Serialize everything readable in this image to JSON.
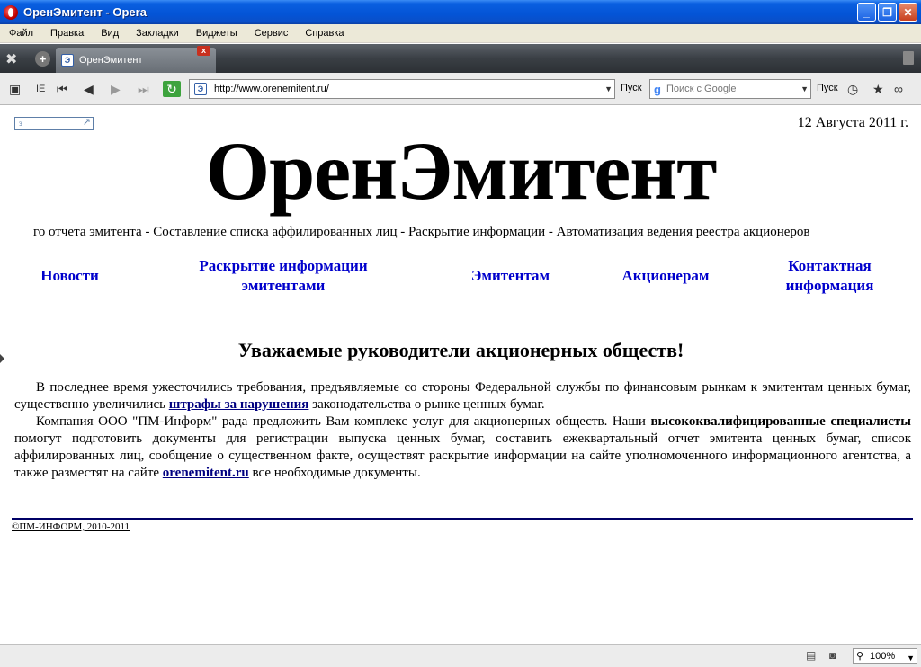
{
  "window": {
    "title": "ОренЭмитент - Opera"
  },
  "menu": [
    "Файл",
    "Правка",
    "Вид",
    "Закладки",
    "Виджеты",
    "Сервис",
    "Справка"
  ],
  "tab": {
    "label": "ОренЭмитент",
    "close": "x"
  },
  "toolbar": {
    "ie_label": "IE",
    "url": "http://www.orenemitent.ru/",
    "go_label": "Пуск",
    "search_placeholder": "Поиск с Google",
    "search_go_label": "Пуск"
  },
  "page": {
    "banner": "э",
    "date": "12 Августа 2011 г.",
    "logo": "ОренЭмитент",
    "tagline": "го отчета эмитента - Составление списка аффилированных лиц - Раскрытие информации - Автоматизация ведения реестра акционеров",
    "nav": [
      "Новости",
      "Раскрытие информации эмитентами",
      "Эмитентам",
      "Акционерам",
      "Контактная информация"
    ],
    "heading": "Уважаемые руководители акционерных обществ!",
    "p1_a": "В последнее время ужесточились требования, предъявляемые со стороны Федеральной службы по финансовым рынкам к эмитентам ценных бумаг, существенно увеличились ",
    "p1_link": "штрафы за нарушения",
    "p1_b": " законодательства о рынке ценных бумаг.",
    "p2_a": "Компания ООО \"ПМ-Информ\" рада предложить Вам комплекс услуг для акционерных обществ. Наши ",
    "p2_bold": "высококвалифицированные специалисты",
    "p2_b": " помогут подготовить документы для регистрации выпуска ценных бумаг, составить ежеквартальный отчет эмитента ценных бумаг, список аффилированных лиц, сообщение о существенном факте, осуществят раскрытие информации на сайте уполномоченного информационного агентства, а также разместят на сайте ",
    "p2_link": "orenemitent.ru",
    "p2_c": " все необходимые документы.",
    "copyright": "©ПМ-ИНФОРМ, 2010-2011"
  },
  "status": {
    "zoom": "100%"
  }
}
